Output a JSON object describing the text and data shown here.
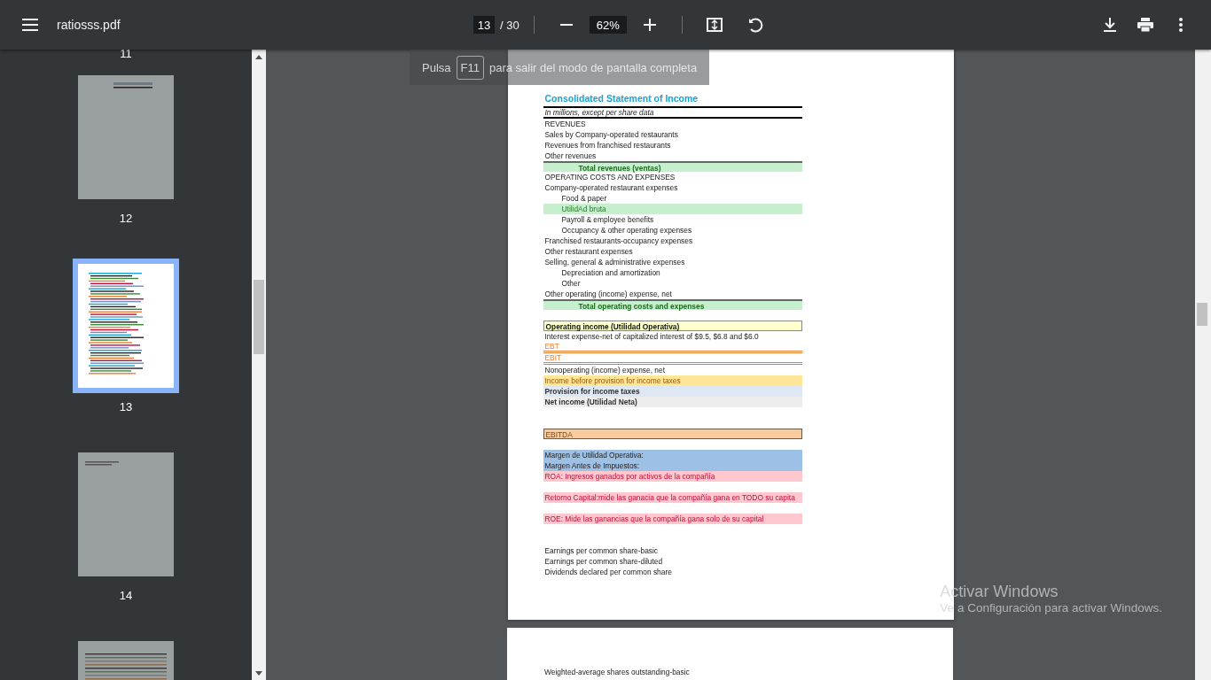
{
  "toolbar": {
    "title": "ratiosss.pdf",
    "page_input": "13",
    "page_total": "/ 30",
    "zoom": "62%"
  },
  "sidebar": {
    "top_label": "11",
    "thumbnails": [
      {
        "label": "12",
        "selected": false,
        "kind": "header"
      },
      {
        "label": "13",
        "selected": true,
        "kind": "statement"
      },
      {
        "label": "14",
        "selected": false,
        "kind": "note"
      },
      {
        "selected": false,
        "kind": "table"
      }
    ]
  },
  "toast": {
    "before": "Pulsa",
    "key": "F11",
    "after": "para salir del modo de pantalla completa"
  },
  "page": {
    "blocks": [
      [
        {
          "kind": "heading",
          "text": "Consolidated Statement of Income"
        },
        {
          "kind": "note",
          "text": "In millions, except per share data"
        },
        {
          "kind": "line",
          "text": "REVENUES"
        },
        {
          "kind": "line",
          "text": "Sales by Company-operated restaurants"
        },
        {
          "kind": "line",
          "text": "Revenues from franchised restaurants"
        },
        {
          "kind": "line",
          "text": "Other revenues"
        },
        {
          "kind": "total",
          "text": "Total revenues (ventas)",
          "color": "#c6efce"
        },
        {
          "kind": "line",
          "text": "OPERATING COSTS AND EXPENSES"
        },
        {
          "kind": "line",
          "text": "Company-operated restaurant expenses"
        },
        {
          "kind": "sub",
          "text": "Food & paper"
        },
        {
          "kind": "sub_good",
          "text": "UtilidAd bruta",
          "color": "#c6efce"
        },
        {
          "kind": "sub",
          "text": "Payroll & employee benefits"
        },
        {
          "kind": "sub",
          "text": "Occupancy & other operating expenses"
        },
        {
          "kind": "line",
          "text": "Franchised restaurants-occupancy expenses"
        },
        {
          "kind": "line",
          "text": "Other restaurant expenses"
        },
        {
          "kind": "line",
          "text": "Selling, general & administrative expenses"
        },
        {
          "kind": "sub",
          "text": "Depreciation and amortization"
        },
        {
          "kind": "sub",
          "text": "Other"
        },
        {
          "kind": "line",
          "text": "Other operating (income) expense, net"
        },
        {
          "kind": "total",
          "text": "Total operating costs and expenses",
          "color": "#c6efce"
        }
      ],
      [
        {
          "kind": "boxed_bold",
          "text": "Operating income (Utilidad Operativa)",
          "color": "#ffffcc"
        },
        {
          "kind": "line",
          "text": "Interest expense-net of capitalized interest of $9.5, $6.8 and $6.0"
        },
        {
          "kind": "orange",
          "text": "EBT"
        },
        {
          "kind": "orange",
          "text": "EBIT"
        },
        {
          "kind": "line",
          "text": "Nonoperating (income) expense, net"
        },
        {
          "kind": "warn",
          "text": "Income before provision for income taxes",
          "color": "#ffe699"
        },
        {
          "kind": "bold",
          "text": "Provision for income taxes",
          "color": "#dde8f4"
        },
        {
          "kind": "bold",
          "text": "Net income (Utilidad Neta)",
          "color": "#ededed"
        }
      ],
      [
        {
          "kind": "boxed",
          "text": "EBITDA",
          "color": "#f8cba0"
        }
      ],
      [
        {
          "kind": "line",
          "text": "Margen de Utilidad Operativa:",
          "color": "#9dc0e6"
        },
        {
          "kind": "line",
          "text": "Margen Antes de Impuestos:",
          "color": "#9dc0e6"
        },
        {
          "kind": "alert",
          "text": "ROA: Ingresos ganados por activos de la compañía",
          "color": "#ffc7ce"
        }
      ],
      [
        {
          "kind": "alert",
          "text": "Retorno Capital:mide las ganacia que la compañía gana en TODO su capita",
          "color": "#ffc7ce"
        }
      ],
      [
        {
          "kind": "alert",
          "text": "ROE: Mide las ganancias que la compañía gana solo de su capital",
          "color": "#ffc7ce"
        }
      ],
      [
        {
          "kind": "line",
          "text": "Earnings per common share-basic"
        },
        {
          "kind": "line",
          "text": "Earnings per common share-diluted"
        },
        {
          "kind": "line",
          "text": "Dividends declared per common share"
        }
      ]
    ]
  },
  "next_page": {
    "text": "Weighted-average shares outstanding-basic"
  },
  "activation": {
    "title": "Activar Windows",
    "text": "Ve a Configuración para activar Windows."
  }
}
